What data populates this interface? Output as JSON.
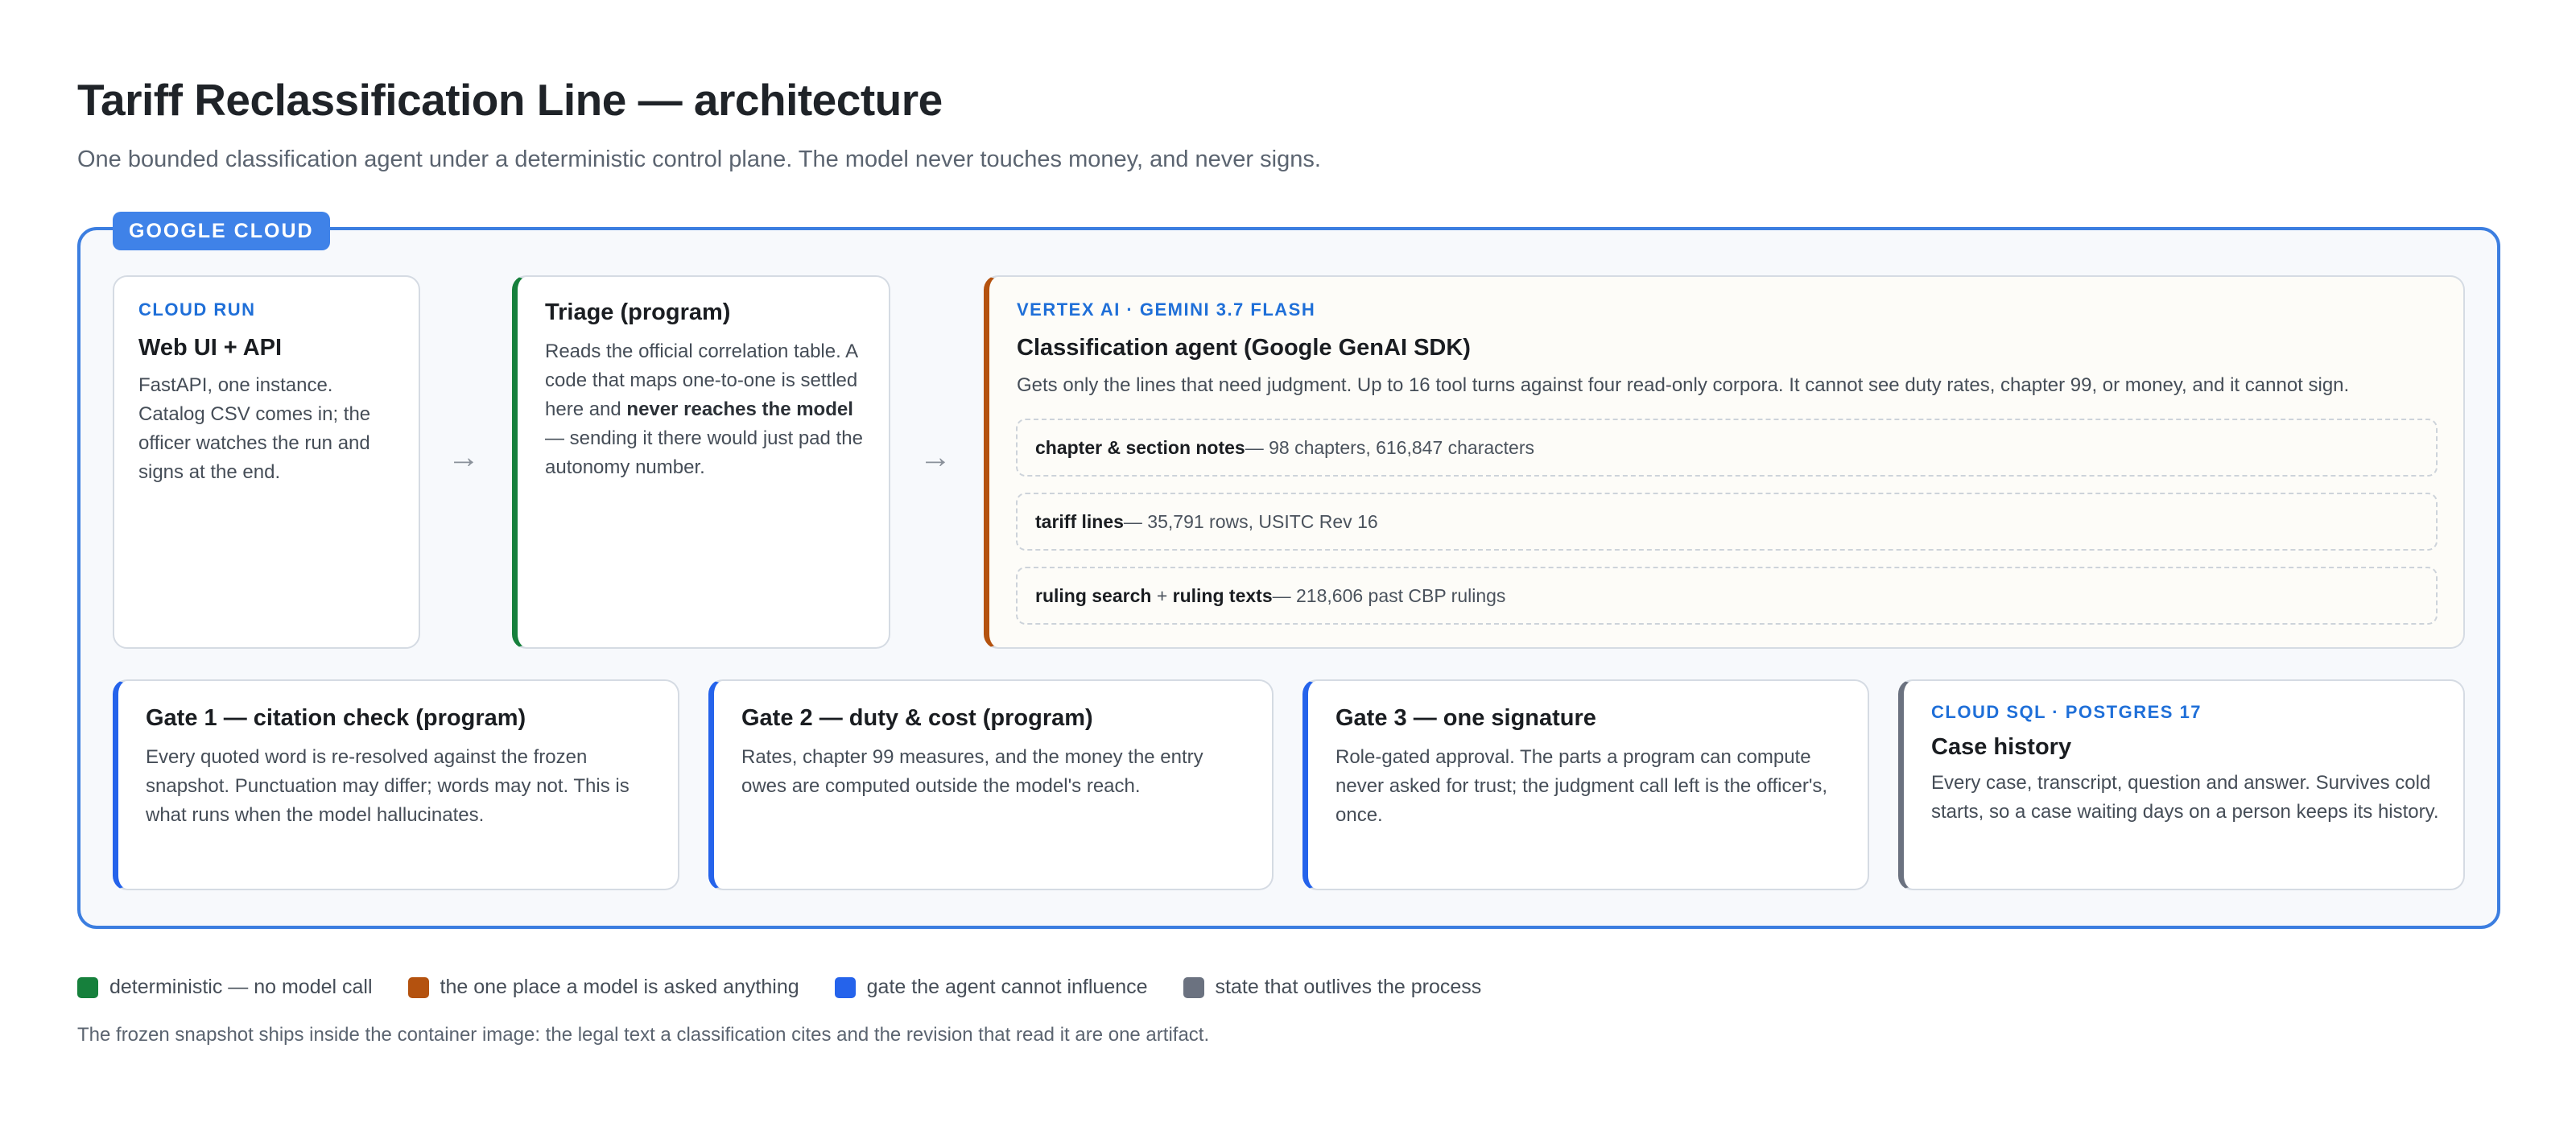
{
  "header": {
    "title": "Tariff Reclassification Line — architecture",
    "subtitle": "One bounded classification agent under a deterministic control plane. The model never touches money, and never signs."
  },
  "cloud": {
    "label": "GOOGLE CLOUD",
    "border_color": "#3c7ee0"
  },
  "web": {
    "kicker": "CLOUD RUN",
    "title": "Web UI + API",
    "body": "FastAPI, one instance. Catalog CSV comes in; the officer watches the run and signs at the end."
  },
  "triage": {
    "title": "Triage (program)",
    "body_pre": "Reads the official correlation table. A code that maps one-to-one is settled here and ",
    "body_bold": "never reaches the model",
    "body_post": " — sending it there would just pad the autonomy number."
  },
  "arrows": [
    "→",
    "→"
  ],
  "agent": {
    "kicker": "VERTEX AI · GEMINI 3.7 FLASH",
    "title": "Classification agent (Google GenAI SDK)",
    "body": "Gets only the lines that need judgment. Up to 16 tool turns against four read-only corpora. It cannot see duty rates, chapter 99, or money, and it cannot sign.",
    "corpora": [
      {
        "name": "chapter & section notes",
        "detail": " — 98 chapters, 616,847 characters"
      },
      {
        "name": "tariff lines",
        "detail": " — 35,791 rows, USITC Rev 16"
      },
      {
        "name_a": "ruling search",
        "plus": " + ",
        "name_b": "ruling texts",
        "detail": " — 218,606 past CBP rulings"
      }
    ]
  },
  "gates": [
    {
      "title": "Gate 1 — citation check (program)",
      "body": "Every quoted word is re-resolved against the frozen snapshot. Punctuation may differ; words may not. This is what runs when the model hallucinates."
    },
    {
      "title": "Gate 2 — duty & cost (program)",
      "body": "Rates, chapter 99 measures, and the money the entry owes are computed outside the model's reach."
    },
    {
      "title": "Gate 3 — one signature",
      "body": "Role-gated approval. The parts a program can compute never asked for trust; the judgment call left is the officer's, once."
    }
  ],
  "history": {
    "kicker": "CLOUD SQL · POSTGRES 17",
    "title": "Case history",
    "body": "Every case, transcript, question and answer. Survives cold starts, so a case waiting days on a person keeps its history."
  },
  "legend": [
    {
      "label": "deterministic — no model call",
      "color": "#16803c"
    },
    {
      "label": "the one place a model is asked anything",
      "color": "#b4520f"
    },
    {
      "label": "gate the agent cannot influence",
      "color": "#2563eb"
    },
    {
      "label": "state that outlives the process",
      "color": "#6b7280"
    }
  ],
  "footnote": "The frozen snapshot ships inside the container image: the legal text a classification cites and the revision that read it are one artifact."
}
